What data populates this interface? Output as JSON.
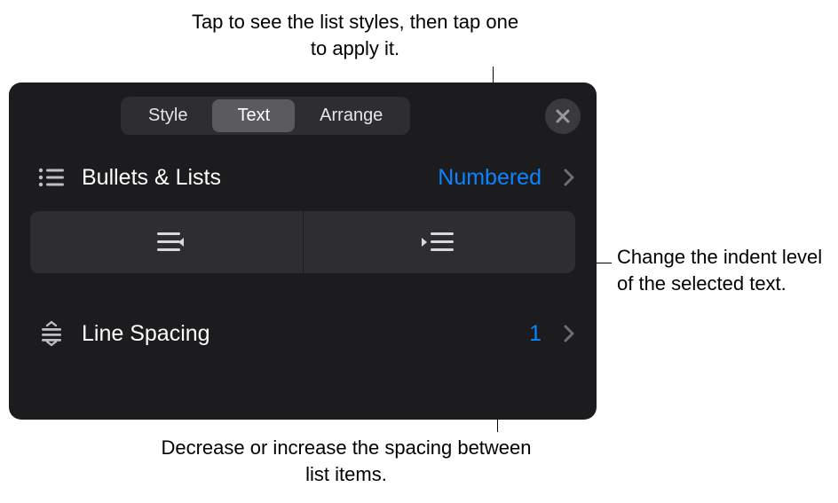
{
  "callouts": {
    "top": "Tap to see the list styles, then tap one to apply it.",
    "right": "Change the indent level of the selected text.",
    "bottom": "Decrease or increase the spacing between list items."
  },
  "panel": {
    "tabs": {
      "style": "Style",
      "text": "Text",
      "arrange": "Arrange"
    },
    "bullets_lists": {
      "label": "Bullets & Lists",
      "value": "Numbered"
    },
    "line_spacing": {
      "label": "Line Spacing",
      "value": "1"
    }
  }
}
